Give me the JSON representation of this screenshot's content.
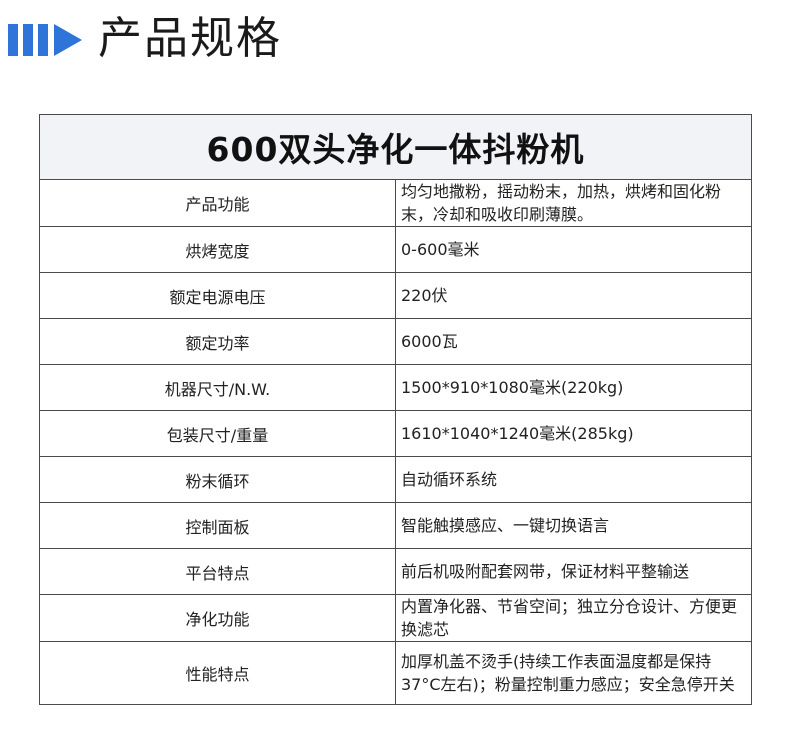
{
  "header": {
    "title": "产品规格",
    "icon": "double-bar-play-icon",
    "accent_color": "#2f74d8"
  },
  "table": {
    "title": "600双头净化一体抖粉机",
    "rows": [
      {
        "label": "产品功能",
        "value": "均匀地撒粉，摇动粉末，加热，烘烤和固化粉末，冷却和吸收印刷薄膜。"
      },
      {
        "label": "烘烤宽度",
        "value": "0-600毫米"
      },
      {
        "label": "额定电源电压",
        "value": "220伏"
      },
      {
        "label": "额定功率",
        "value": "6000瓦"
      },
      {
        "label": "机器尺寸/N.W.",
        "value": "1500*910*1080毫米(220kg)"
      },
      {
        "label": "包装尺寸/重量",
        "value": "1610*1040*1240毫米(285kg)"
      },
      {
        "label": "粉末循环",
        "value": "自动循环系统"
      },
      {
        "label": "控制面板",
        "value": "智能触摸感应、一键切换语言"
      },
      {
        "label": "平台特点",
        "value": "前后机吸附配套网带，保证材料平整输送"
      },
      {
        "label": "净化功能",
        "value": "内置净化器、节省空间；独立分仓设计、方便更换滤芯"
      },
      {
        "label": "性能特点",
        "value": "加厚机盖不烫手(持续工作表面温度都是保持37°C左右)；粉量控制重力感应；安全急停开关"
      }
    ]
  }
}
